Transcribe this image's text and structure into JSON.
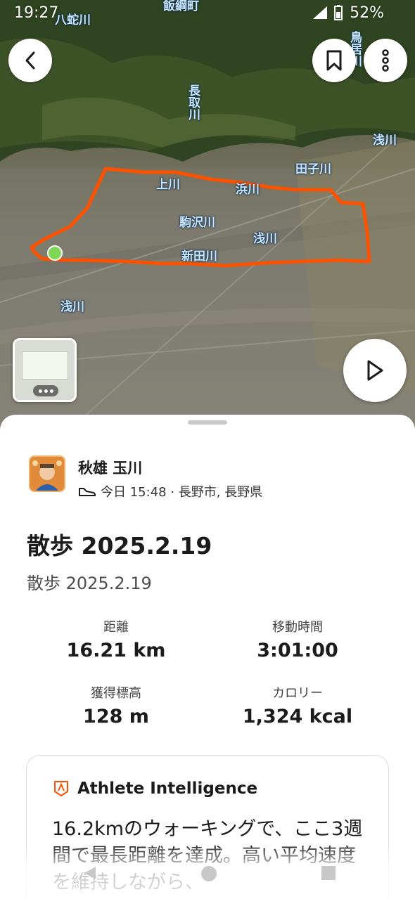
{
  "status_bar": {
    "time": "19:27",
    "battery": "52%"
  },
  "map": {
    "labels": [
      {
        "id": "yatsubagawa",
        "text": "八蛇川"
      },
      {
        "id": "torii",
        "text": "鳥居川"
      },
      {
        "id": "tsukamachi",
        "text": "飯綱町"
      },
      {
        "id": "tokigawa",
        "text": "長取川"
      },
      {
        "id": "asagawa-ne",
        "text": "浅川"
      },
      {
        "id": "tagogawa",
        "text": "田子川"
      },
      {
        "id": "hamagawa",
        "text": "浜川"
      },
      {
        "id": "kusagawa",
        "text": "駒沢川"
      },
      {
        "id": "ogawa",
        "text": "上川"
      },
      {
        "id": "asagawa-mid",
        "text": "浅川"
      },
      {
        "id": "shindagawa",
        "text": "新田川"
      },
      {
        "id": "asagawa-sw",
        "text": "浅川"
      }
    ],
    "route_color": "#fc5200",
    "start_color": "#7ed957"
  },
  "athlete": {
    "name": "秋雄 玉川",
    "meta": "今日 15:48 · 長野市, 長野県",
    "activity_icon": "walking-shoe-icon"
  },
  "activity": {
    "title": "散歩 2025.2.19",
    "description": "散歩 2025.2.19"
  },
  "stats": {
    "distance_label": "距離",
    "distance_value": "16.21 km",
    "moving_time_label": "移動時間",
    "moving_time_value": "3:01:00",
    "elevation_label": "獲得標高",
    "elevation_value": "128 m",
    "calories_label": "カロリー",
    "calories_value": "1,324 kcal"
  },
  "athlete_intelligence": {
    "title": "Athlete Intelligence",
    "text": "16.2kmのウォーキングで、ここ3週間で最長距離を達成。高い平均速度を維持しながら、"
  },
  "colors": {
    "brand": "#fc5200",
    "text_primary": "#1b1b1b",
    "text_secondary": "#4d4d4d"
  }
}
